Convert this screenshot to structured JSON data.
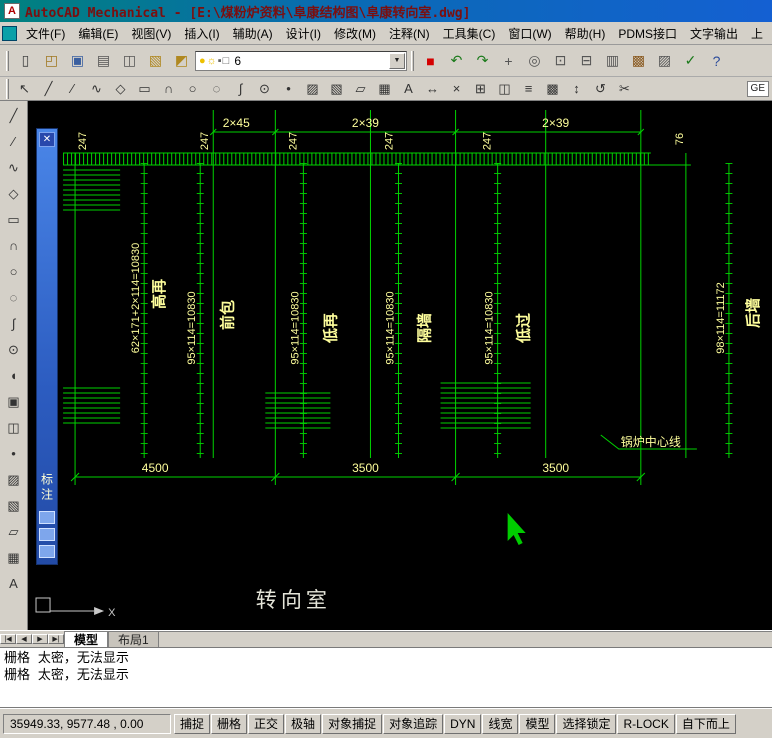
{
  "title_bar": {
    "title": "AutoCAD Mechanical - [E:\\煤粉炉资料\\阜康结构图\\阜康转向室.dwg]",
    "app_initial": "A"
  },
  "menu": {
    "items": [
      {
        "name": "file-menu",
        "label": "文件(F)"
      },
      {
        "name": "edit-menu",
        "label": "编辑(E)"
      },
      {
        "name": "view-menu",
        "label": "视图(V)"
      },
      {
        "name": "insert-menu",
        "label": "插入(I)"
      },
      {
        "name": "assist-menu",
        "label": "辅助(A)"
      },
      {
        "name": "design-menu",
        "label": "设计(I)"
      },
      {
        "name": "modify-menu",
        "label": "修改(M)"
      },
      {
        "name": "annotate-menu",
        "label": "注释(N)"
      },
      {
        "name": "toolsets-menu",
        "label": "工具集(C)"
      },
      {
        "name": "window-menu",
        "label": "窗口(W)"
      },
      {
        "name": "help-menu",
        "label": "帮助(H)"
      },
      {
        "name": "pdms-interface-menu",
        "label": "PDMS接口"
      },
      {
        "name": "text-output-menu",
        "label": "文字输出"
      },
      {
        "name": "partial-menu",
        "label": "上"
      }
    ]
  },
  "toolbar_top": {
    "icons_left": [
      {
        "name": "new-file-icon",
        "glyph": "▯",
        "color": "#444"
      },
      {
        "name": "open-file-icon",
        "glyph": "◰",
        "color": "#a07820"
      },
      {
        "name": "save-file-icon",
        "glyph": "▣",
        "color": "#3a5fa0"
      },
      {
        "name": "plot-icon",
        "glyph": "▤",
        "color": "#555"
      },
      {
        "name": "plot-preview-icon",
        "glyph": "◫",
        "color": "#555"
      },
      {
        "name": "layer-properties-icon",
        "glyph": "▧",
        "color": "#b08820"
      },
      {
        "name": "layer-states-icon",
        "glyph": "◩",
        "color": "#b08820"
      }
    ],
    "combo": {
      "value": "6",
      "icons": [
        {
          "name": "layer-on-bulb-icon",
          "glyph": "●",
          "color": "#edc000"
        },
        {
          "name": "layer-thaw-sun-icon",
          "glyph": "☼",
          "color": "#edc000"
        },
        {
          "name": "layer-lock-icon",
          "glyph": "▪",
          "color": "#606060"
        },
        {
          "name": "layer-color-swatch-icon",
          "glyph": "□",
          "color": "#606060"
        }
      ]
    },
    "icons_right": [
      {
        "name": "color-control-icon",
        "glyph": "■",
        "color": "#d40000"
      },
      {
        "name": "undo-icon",
        "glyph": "↶",
        "color": "#1a7a1a"
      },
      {
        "name": "redo-icon",
        "glyph": "↷",
        "color": "#1a7a1a"
      },
      {
        "name": "pan-icon",
        "glyph": "+",
        "color": "#555"
      },
      {
        "name": "zoom-realtime-icon",
        "glyph": "◎",
        "color": "#555"
      },
      {
        "name": "zoom-window-icon",
        "glyph": "⊡",
        "color": "#555"
      },
      {
        "name": "zoom-previous-icon",
        "glyph": "⊟",
        "color": "#555"
      },
      {
        "name": "properties-icon",
        "glyph": "▥",
        "color": "#555"
      },
      {
        "name": "design-center-icon",
        "glyph": "▩",
        "color": "#8a5a20"
      },
      {
        "name": "tool-palettes-icon",
        "glyph": "▨",
        "color": "#555"
      },
      {
        "name": "markup-check-icon",
        "glyph": "✓",
        "color": "#1a7a1a"
      },
      {
        "name": "help-question-icon",
        "glyph": "?",
        "color": "#2a4a9a"
      }
    ]
  },
  "toolbar_draw": {
    "icons": [
      {
        "name": "select-icon",
        "glyph": "↖"
      },
      {
        "name": "line-icon",
        "glyph": "╱"
      },
      {
        "name": "xline-icon",
        "glyph": "∕"
      },
      {
        "name": "polyline-icon",
        "glyph": "∿"
      },
      {
        "name": "polygon-icon",
        "glyph": "◇"
      },
      {
        "name": "rectangle-icon",
        "glyph": "▭"
      },
      {
        "name": "arc-icon",
        "glyph": "∩"
      },
      {
        "name": "circle-icon",
        "glyph": "○"
      },
      {
        "name": "revcloud-icon",
        "glyph": "◌"
      },
      {
        "name": "spline-icon",
        "glyph": "∫"
      },
      {
        "name": "ellipse-icon",
        "glyph": "⊙"
      },
      {
        "name": "point-icon",
        "glyph": "•"
      },
      {
        "name": "hatch-icon",
        "glyph": "▨"
      },
      {
        "name": "gradient-icon",
        "glyph": "▧"
      },
      {
        "name": "region-icon",
        "glyph": "▱"
      },
      {
        "name": "table-icon",
        "glyph": "▦"
      },
      {
        "name": "text-icon",
        "glyph": "A"
      },
      {
        "name": "dim-linear-icon",
        "glyph": "↔"
      },
      {
        "name": "erase-icon",
        "glyph": "×"
      },
      {
        "name": "copy-icon",
        "glyph": "⊞"
      },
      {
        "name": "mirror-icon",
        "glyph": "◫"
      },
      {
        "name": "offset-icon",
        "glyph": "≡"
      },
      {
        "name": "array-icon",
        "glyph": "▩"
      },
      {
        "name": "move-icon",
        "glyph": "↕"
      },
      {
        "name": "rotate-icon",
        "glyph": "↺"
      },
      {
        "name": "trim-icon",
        "glyph": "✂"
      }
    ],
    "right_label": "GE"
  },
  "left_toolbar": {
    "icons": [
      {
        "name": "line-tool-icon",
        "glyph": "╱"
      },
      {
        "name": "xline-tool-icon",
        "glyph": "∕"
      },
      {
        "name": "polyline-tool-icon",
        "glyph": "∿"
      },
      {
        "name": "polygon-tool-icon",
        "glyph": "◇"
      },
      {
        "name": "rectangle-tool-icon",
        "glyph": "▭"
      },
      {
        "name": "arc-tool-icon",
        "glyph": "∩"
      },
      {
        "name": "circle-tool-icon",
        "glyph": "○"
      },
      {
        "name": "revcloud-tool-icon",
        "glyph": "◌"
      },
      {
        "name": "spline-tool-icon",
        "glyph": "∫"
      },
      {
        "name": "ellipse-tool-icon",
        "glyph": "⊙"
      },
      {
        "name": "ellipse-arc-tool-icon",
        "glyph": "◖"
      },
      {
        "name": "insert-block-tool-icon",
        "glyph": "▣"
      },
      {
        "name": "make-block-tool-icon",
        "glyph": "◫"
      },
      {
        "name": "point-tool-icon",
        "glyph": "•"
      },
      {
        "name": "hatch-tool-icon",
        "glyph": "▨"
      },
      {
        "name": "gradient-tool-icon",
        "glyph": "▧"
      },
      {
        "name": "region-tool-icon",
        "glyph": "▱"
      },
      {
        "name": "table-tool-icon",
        "glyph": "▦"
      },
      {
        "name": "text-tool-icon",
        "glyph": "A"
      }
    ]
  },
  "palette": {
    "title_vertical": "标注",
    "close_glyph": "✕",
    "icons": [
      {
        "name": "palette-icon-1"
      },
      {
        "name": "palette-icon-2"
      },
      {
        "name": "palette-icon-3"
      }
    ]
  },
  "canvas": {
    "dims_top": [
      "2×45",
      "2×39",
      "2×39"
    ],
    "pitch_labels": [
      "247",
      "247",
      "247",
      "247",
      "247"
    ],
    "right_pitch": "76",
    "col_dims": [
      {
        "value": "62×171+2×114=10830",
        "label": "高再"
      },
      {
        "value": "95×114=10830",
        "label": "前包"
      },
      {
        "value": "95×114=10830",
        "label": "低再"
      },
      {
        "value": "95×114=10830",
        "label": "隔墙"
      },
      {
        "value": "95×114=10830",
        "label": "低过"
      },
      {
        "value": "98×114=11172",
        "label": "后墙"
      }
    ],
    "dims_bottom": [
      "4500",
      "3500",
      "3500"
    ],
    "leader_label": "锅炉中心线",
    "room_label": "转向室",
    "ucs_axis": "X"
  },
  "tabs": {
    "scroll_buttons": [
      {
        "name": "tab-first-button",
        "label": "|◀"
      },
      {
        "name": "tab-prev-button",
        "label": "◀"
      },
      {
        "name": "tab-next-button",
        "label": "▶"
      },
      {
        "name": "tab-last-button",
        "label": "▶|"
      }
    ],
    "items": [
      {
        "name": "tab-model",
        "label": "模型",
        "active": true
      },
      {
        "name": "tab-layout1",
        "label": "布局1",
        "active": false
      }
    ]
  },
  "command": {
    "lines": [
      "栅格 太密，无法显示",
      "栅格 太密，无法显示"
    ]
  },
  "status": {
    "coords": "35949.33, 9577.48 , 0.00",
    "toggles": [
      {
        "name": "snap-toggle",
        "label": "捕捉"
      },
      {
        "name": "grid-toggle",
        "label": "栅格"
      },
      {
        "name": "ortho-toggle",
        "label": "正交"
      },
      {
        "name": "polar-toggle",
        "label": "极轴"
      },
      {
        "name": "osnap-toggle",
        "label": "对象捕捉"
      },
      {
        "name": "otrack-toggle",
        "label": "对象追踪"
      },
      {
        "name": "dyn-toggle",
        "label": "DYN"
      },
      {
        "name": "lineweight-toggle",
        "label": "线宽"
      },
      {
        "name": "model-toggle",
        "label": "模型"
      },
      {
        "name": "selection-lock-toggle",
        "label": "选择锁定"
      },
      {
        "name": "r-lock-toggle",
        "label": "R-LOCK"
      },
      {
        "name": "bottom-up-toggle",
        "label": "自下而上"
      }
    ]
  },
  "colors": {
    "drawing_line": "#00d200",
    "dimension_text": "#ffff9c",
    "title_text": "#7b0f0f"
  }
}
